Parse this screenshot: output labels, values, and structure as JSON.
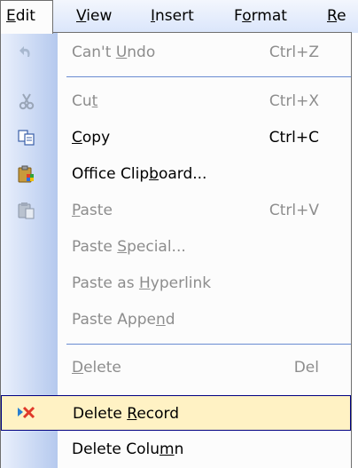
{
  "menubar": {
    "items": [
      {
        "pre": "",
        "u": "E",
        "post": "dit"
      },
      {
        "pre": "",
        "u": "V",
        "post": "iew"
      },
      {
        "pre": "",
        "u": "I",
        "post": "nsert"
      },
      {
        "pre": "F",
        "u": "o",
        "post": "rmat"
      },
      {
        "pre": "",
        "u": "R",
        "post": "e"
      }
    ]
  },
  "menu": {
    "items": [
      {
        "icon": "undo-icon",
        "pre": "Can't ",
        "u": "U",
        "post": "ndo",
        "shortcut": "Ctrl+Z",
        "enabled": false
      },
      {
        "icon": "cut-icon",
        "pre": "Cu",
        "u": "t",
        "post": "",
        "shortcut": "Ctrl+X",
        "enabled": false
      },
      {
        "icon": "copy-icon",
        "pre": "",
        "u": "C",
        "post": "opy",
        "shortcut": "Ctrl+C",
        "enabled": true
      },
      {
        "icon": "office-clipboard-icon",
        "pre": "Office Clip",
        "u": "b",
        "post": "oard...",
        "shortcut": "",
        "enabled": true
      },
      {
        "icon": "paste-icon",
        "pre": "",
        "u": "P",
        "post": "aste",
        "shortcut": "Ctrl+V",
        "enabled": false
      },
      {
        "icon": "",
        "pre": "Paste ",
        "u": "S",
        "post": "pecial...",
        "shortcut": "",
        "enabled": false
      },
      {
        "icon": "",
        "pre": "Paste as ",
        "u": "H",
        "post": "yperlink",
        "shortcut": "",
        "enabled": false
      },
      {
        "icon": "",
        "pre": "Paste Appe",
        "u": "n",
        "post": "d",
        "shortcut": "",
        "enabled": false
      },
      {
        "icon": "",
        "pre": "",
        "u": "D",
        "post": "elete",
        "shortcut": "Del",
        "enabled": false
      },
      {
        "icon": "delete-record-icon",
        "pre": "Delete ",
        "u": "R",
        "post": "ecord",
        "shortcut": "",
        "enabled": true
      },
      {
        "icon": "",
        "pre": "Delete Colu",
        "u": "m",
        "post": "n",
        "shortcut": "",
        "enabled": true
      }
    ]
  },
  "colors": {
    "menu_bg": "#fcfcfc",
    "gutter_start": "#eaf0fc",
    "gutter_end": "#b5c9ee",
    "highlight_bg": "#fff2c4",
    "highlight_border": "#000080",
    "disabled_text": "#8d8d8d",
    "separator": "#6a8cd2"
  }
}
